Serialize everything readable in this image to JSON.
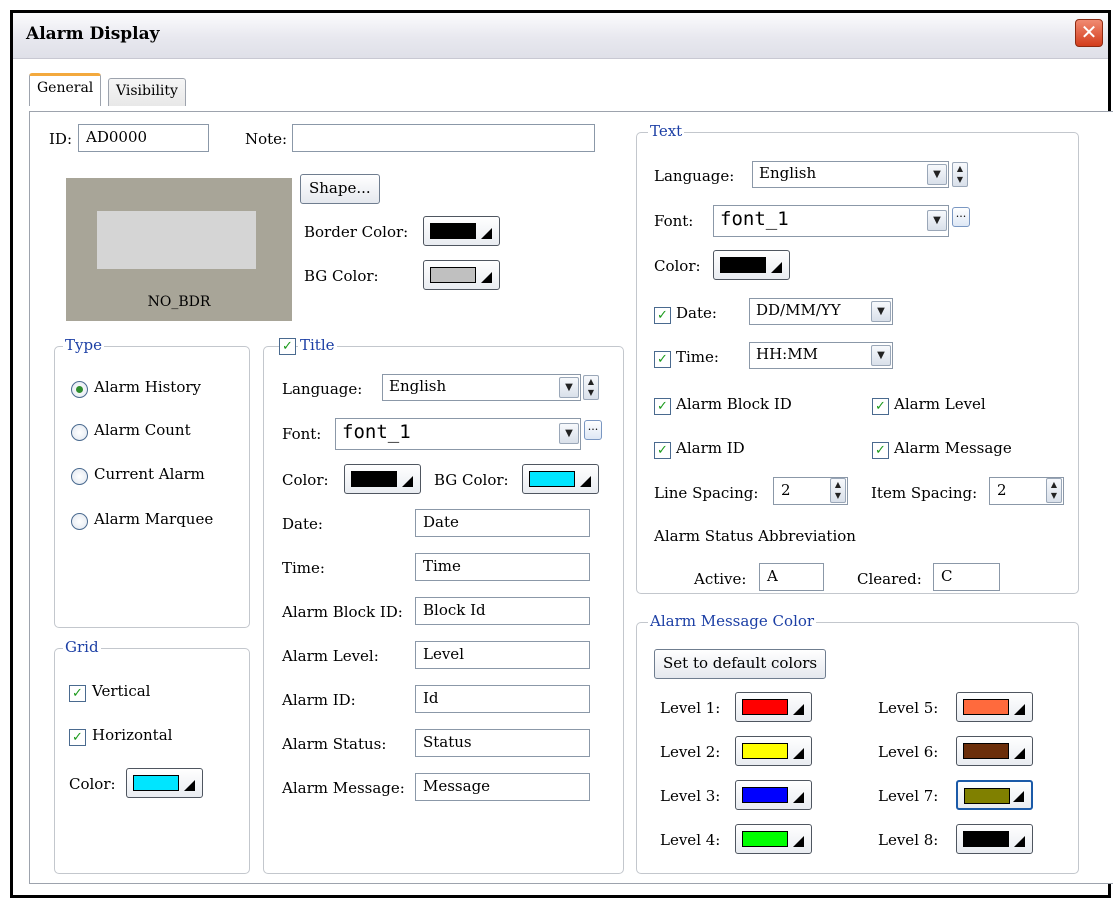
{
  "window": {
    "title": "Alarm Display"
  },
  "tabs": [
    "General",
    "Visibility"
  ],
  "general": {
    "id_label": "ID:",
    "id_value": "AD0000",
    "note_label": "Note:",
    "note_value": "",
    "shape_button": "Shape...",
    "border_color_label": "Border Color:",
    "border_color": "#000000",
    "bg_color_label": "BG Color:",
    "bg_color": "#c0c0c0",
    "preview_caption": "NO_BDR"
  },
  "type": {
    "label": "Type",
    "options": [
      "Alarm History",
      "Alarm Count",
      "Current Alarm",
      "Alarm Marquee"
    ],
    "selected": "Alarm History"
  },
  "grid": {
    "label": "Grid",
    "vertical_label": "Vertical",
    "vertical": true,
    "horizontal_label": "Horizontal",
    "horizontal": true,
    "color_label": "Color:",
    "color": "#00e5ff"
  },
  "title_group": {
    "label": "Title",
    "enabled": true,
    "language_label": "Language:",
    "language": "English",
    "font_label": "Font:",
    "font": "font_1",
    "color_label": "Color:",
    "color": "#000000",
    "bg_color_label": "BG Color:",
    "bg_color": "#00e5ff",
    "fields": [
      {
        "label": "Date:",
        "value": "Date"
      },
      {
        "label": "Time:",
        "value": "Time"
      },
      {
        "label": "Alarm Block ID:",
        "value": "Block Id"
      },
      {
        "label": "Alarm Level:",
        "value": "Level"
      },
      {
        "label": "Alarm ID:",
        "value": "Id"
      },
      {
        "label": "Alarm Status:",
        "value": "Status"
      },
      {
        "label": "Alarm Message:",
        "value": "Message"
      }
    ]
  },
  "text_group": {
    "label": "Text",
    "language_label": "Language:",
    "language": "English",
    "font_label": "Font:",
    "font": "font_1",
    "color_label": "Color:",
    "color": "#000000",
    "date_label": "Date:",
    "date_checked": true,
    "date_format": "DD/MM/YY",
    "time_label": "Time:",
    "time_checked": true,
    "time_format": "HH:MM",
    "alarm_block_id_label": "Alarm Block ID",
    "alarm_level_label": "Alarm Level",
    "alarm_id_label": "Alarm ID",
    "alarm_message_label": "Alarm Message",
    "line_spacing_label": "Line Spacing:",
    "line_spacing": "2",
    "item_spacing_label": "Item Spacing:",
    "item_spacing": "2",
    "status_abbrev_label": "Alarm Status Abbreviation",
    "active_label": "Active:",
    "active": "A",
    "cleared_label": "Cleared:",
    "cleared": "C"
  },
  "message_color": {
    "label": "Alarm Message Color",
    "default_button": "Set to default colors",
    "levels": [
      {
        "label": "Level 1:",
        "color": "#ff0000"
      },
      {
        "label": "Level 2:",
        "color": "#ffff00"
      },
      {
        "label": "Level 3:",
        "color": "#0000ff"
      },
      {
        "label": "Level 4:",
        "color": "#00ff00"
      },
      {
        "label": "Level 5:",
        "color": "#ff6a3d"
      },
      {
        "label": "Level 6:",
        "color": "#6b2e0a"
      },
      {
        "label": "Level 7:",
        "color": "#808000"
      },
      {
        "label": "Level 8:",
        "color": "#000000"
      }
    ]
  }
}
